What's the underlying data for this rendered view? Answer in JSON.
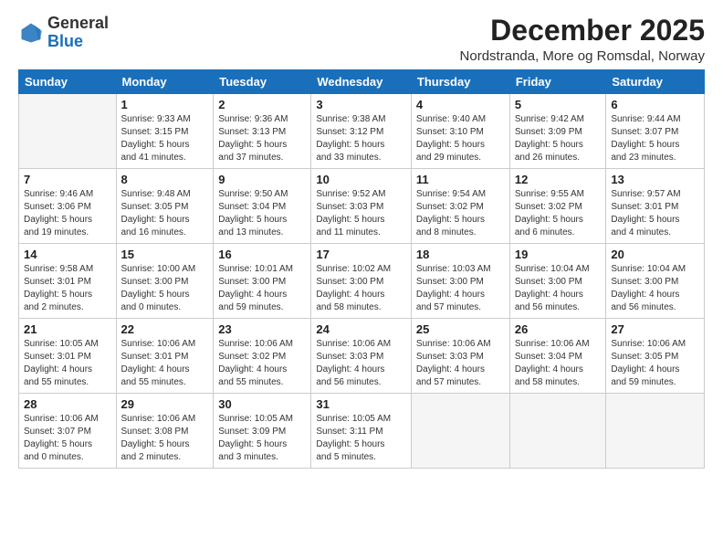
{
  "logo": {
    "general": "General",
    "blue": "Blue"
  },
  "header": {
    "month": "December 2025",
    "location": "Nordstranda, More og Romsdal, Norway"
  },
  "days_of_week": [
    "Sunday",
    "Monday",
    "Tuesday",
    "Wednesday",
    "Thursday",
    "Friday",
    "Saturday"
  ],
  "weeks": [
    [
      {
        "day": "",
        "info": ""
      },
      {
        "day": "1",
        "info": "Sunrise: 9:33 AM\nSunset: 3:15 PM\nDaylight: 5 hours\nand 41 minutes."
      },
      {
        "day": "2",
        "info": "Sunrise: 9:36 AM\nSunset: 3:13 PM\nDaylight: 5 hours\nand 37 minutes."
      },
      {
        "day": "3",
        "info": "Sunrise: 9:38 AM\nSunset: 3:12 PM\nDaylight: 5 hours\nand 33 minutes."
      },
      {
        "day": "4",
        "info": "Sunrise: 9:40 AM\nSunset: 3:10 PM\nDaylight: 5 hours\nand 29 minutes."
      },
      {
        "day": "5",
        "info": "Sunrise: 9:42 AM\nSunset: 3:09 PM\nDaylight: 5 hours\nand 26 minutes."
      },
      {
        "day": "6",
        "info": "Sunrise: 9:44 AM\nSunset: 3:07 PM\nDaylight: 5 hours\nand 23 minutes."
      }
    ],
    [
      {
        "day": "7",
        "info": "Sunrise: 9:46 AM\nSunset: 3:06 PM\nDaylight: 5 hours\nand 19 minutes."
      },
      {
        "day": "8",
        "info": "Sunrise: 9:48 AM\nSunset: 3:05 PM\nDaylight: 5 hours\nand 16 minutes."
      },
      {
        "day": "9",
        "info": "Sunrise: 9:50 AM\nSunset: 3:04 PM\nDaylight: 5 hours\nand 13 minutes."
      },
      {
        "day": "10",
        "info": "Sunrise: 9:52 AM\nSunset: 3:03 PM\nDaylight: 5 hours\nand 11 minutes."
      },
      {
        "day": "11",
        "info": "Sunrise: 9:54 AM\nSunset: 3:02 PM\nDaylight: 5 hours\nand 8 minutes."
      },
      {
        "day": "12",
        "info": "Sunrise: 9:55 AM\nSunset: 3:02 PM\nDaylight: 5 hours\nand 6 minutes."
      },
      {
        "day": "13",
        "info": "Sunrise: 9:57 AM\nSunset: 3:01 PM\nDaylight: 5 hours\nand 4 minutes."
      }
    ],
    [
      {
        "day": "14",
        "info": "Sunrise: 9:58 AM\nSunset: 3:01 PM\nDaylight: 5 hours\nand 2 minutes."
      },
      {
        "day": "15",
        "info": "Sunrise: 10:00 AM\nSunset: 3:00 PM\nDaylight: 5 hours\nand 0 minutes."
      },
      {
        "day": "16",
        "info": "Sunrise: 10:01 AM\nSunset: 3:00 PM\nDaylight: 4 hours\nand 59 minutes."
      },
      {
        "day": "17",
        "info": "Sunrise: 10:02 AM\nSunset: 3:00 PM\nDaylight: 4 hours\nand 58 minutes."
      },
      {
        "day": "18",
        "info": "Sunrise: 10:03 AM\nSunset: 3:00 PM\nDaylight: 4 hours\nand 57 minutes."
      },
      {
        "day": "19",
        "info": "Sunrise: 10:04 AM\nSunset: 3:00 PM\nDaylight: 4 hours\nand 56 minutes."
      },
      {
        "day": "20",
        "info": "Sunrise: 10:04 AM\nSunset: 3:00 PM\nDaylight: 4 hours\nand 56 minutes."
      }
    ],
    [
      {
        "day": "21",
        "info": "Sunrise: 10:05 AM\nSunset: 3:01 PM\nDaylight: 4 hours\nand 55 minutes."
      },
      {
        "day": "22",
        "info": "Sunrise: 10:06 AM\nSunset: 3:01 PM\nDaylight: 4 hours\nand 55 minutes."
      },
      {
        "day": "23",
        "info": "Sunrise: 10:06 AM\nSunset: 3:02 PM\nDaylight: 4 hours\nand 55 minutes."
      },
      {
        "day": "24",
        "info": "Sunrise: 10:06 AM\nSunset: 3:03 PM\nDaylight: 4 hours\nand 56 minutes."
      },
      {
        "day": "25",
        "info": "Sunrise: 10:06 AM\nSunset: 3:03 PM\nDaylight: 4 hours\nand 57 minutes."
      },
      {
        "day": "26",
        "info": "Sunrise: 10:06 AM\nSunset: 3:04 PM\nDaylight: 4 hours\nand 58 minutes."
      },
      {
        "day": "27",
        "info": "Sunrise: 10:06 AM\nSunset: 3:05 PM\nDaylight: 4 hours\nand 59 minutes."
      }
    ],
    [
      {
        "day": "28",
        "info": "Sunrise: 10:06 AM\nSunset: 3:07 PM\nDaylight: 5 hours\nand 0 minutes."
      },
      {
        "day": "29",
        "info": "Sunrise: 10:06 AM\nSunset: 3:08 PM\nDaylight: 5 hours\nand 2 minutes."
      },
      {
        "day": "30",
        "info": "Sunrise: 10:05 AM\nSunset: 3:09 PM\nDaylight: 5 hours\nand 3 minutes."
      },
      {
        "day": "31",
        "info": "Sunrise: 10:05 AM\nSunset: 3:11 PM\nDaylight: 5 hours\nand 5 minutes."
      },
      {
        "day": "",
        "info": ""
      },
      {
        "day": "",
        "info": ""
      },
      {
        "day": "",
        "info": ""
      }
    ]
  ]
}
